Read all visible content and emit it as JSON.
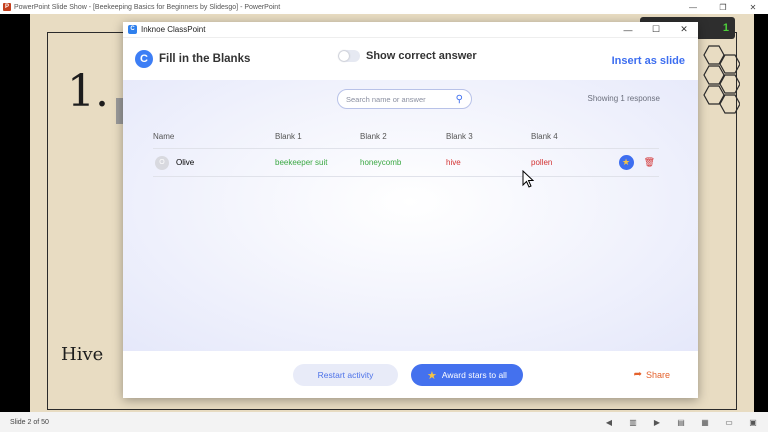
{
  "ppt": {
    "window_title": "PowerPoint Slide Show - [Beekeeping Basics for Beginners by Slidesgo] - PowerPoint",
    "slide_info": "Slide 2 of 50",
    "slide_number_text": "1.",
    "slide_hive_text": "Hive",
    "slide_badge_text": "1"
  },
  "dialog": {
    "window_title": "Inknoe ClassPoint",
    "activity_title": "Fill in the Blanks",
    "toggle_label": "Show correct answer",
    "toggle_on": false,
    "insert_label": "Insert as slide",
    "search_placeholder": "Search name or answer",
    "response_count": "Showing 1 response",
    "columns": [
      "Name",
      "Blank 1",
      "Blank 2",
      "Blank 3",
      "Blank 4"
    ],
    "rows": [
      {
        "avatar": "O",
        "name": "Olive",
        "blanks": [
          {
            "text": "beekeeper suit",
            "status": "correct"
          },
          {
            "text": "honeycomb",
            "status": "correct"
          },
          {
            "text": "hive",
            "status": "wrong"
          },
          {
            "text": "pollen",
            "status": "wrong"
          }
        ]
      }
    ],
    "footer": {
      "restart_label": "Restart activity",
      "award_label": "Award stars to all",
      "share_label": "Share"
    }
  },
  "colors": {
    "accent": "#4471ee",
    "correct": "#3aa843",
    "wrong": "#d33232",
    "share": "#e4622d"
  },
  "icons": [
    "powerpoint-logo",
    "classpoint-logo",
    "search-icon",
    "star-icon",
    "trash-icon",
    "share-icon",
    "mouse-cursor"
  ]
}
